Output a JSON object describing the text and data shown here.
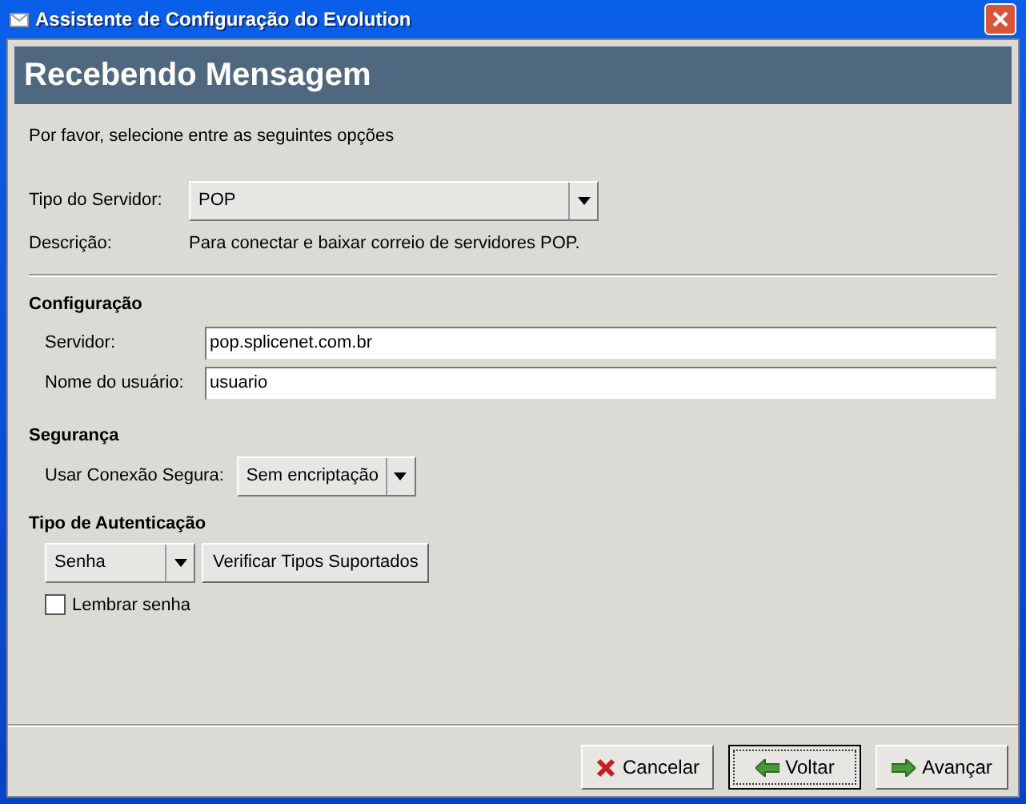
{
  "window": {
    "title": "Assistente de Configuração do Evolution"
  },
  "page": {
    "title": "Recebendo Mensagem",
    "intro": "Por favor, selecione entre as seguintes opções"
  },
  "server_type": {
    "label": "Tipo do Servidor:",
    "value": "POP"
  },
  "description": {
    "label": "Descrição:",
    "text": "Para conectar e baixar correio de servidores POP."
  },
  "configuration": {
    "heading": "Configuração",
    "fields": [
      {
        "label": "Servidor:",
        "value": "pop.splicenet.com.br"
      },
      {
        "label": "Nome do usuário:",
        "value": "usuario"
      }
    ]
  },
  "security": {
    "heading": "Segurança",
    "label": "Usar Conexão Segura:",
    "value": "Sem encriptação"
  },
  "authentication": {
    "heading": "Tipo de Autenticação",
    "value": "Senha",
    "check_button": "Verificar Tipos Suportados",
    "remember": {
      "label": "Lembrar senha",
      "checked": false
    }
  },
  "buttons": [
    {
      "label": "Cancelar",
      "kind": "cancel",
      "focused": false
    },
    {
      "label": "Voltar",
      "kind": "back",
      "focused": true
    },
    {
      "label": "Avançar",
      "kind": "forward",
      "focused": false
    }
  ]
}
